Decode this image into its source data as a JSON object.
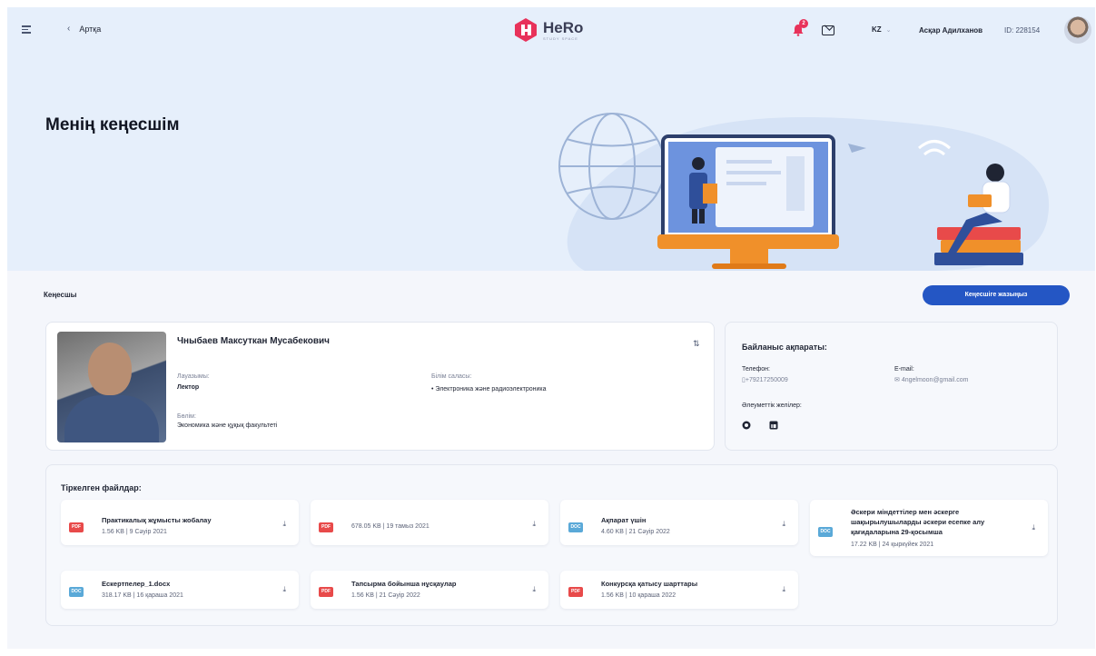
{
  "header": {
    "back_label": "Артқа",
    "logo_text": "HeRo",
    "logo_sub": "STUDY SPACE",
    "notification_count": "2",
    "lang": "KZ",
    "user_name": "Асқар Адилханов",
    "user_id": "ID: 228154"
  },
  "page": {
    "title": "Менің кеңесшім"
  },
  "consultant": {
    "section_label": "Кеңесшы",
    "signup_button": "Кеңесшіге жазыңыз",
    "name": "Чныбаев Максуткан Мусабекович",
    "position_label": "Лауазымы:",
    "position_value": "Лектор",
    "department_label": "Бөлім:",
    "department_value": "Экономика және құқық факультеті",
    "field_label": "Білім саласы:",
    "field_value": "• Электроника және радиоэлектроника"
  },
  "contacts": {
    "title": "Байланыс ақпараты:",
    "phone_label": "Телефон:",
    "phone_value": "+79217250009",
    "email_label": "E-mail:",
    "email_value": "4ngelmoon@gmail.com",
    "social_label": "Әлеуметтік желілер:"
  },
  "files": {
    "title": "Тіркелген файлдар:",
    "items": [
      {
        "type": "PDF",
        "name": "Практикалық жұмысты жобалау",
        "size": "1.56 KB",
        "date": "9 Сәуір 2021"
      },
      {
        "type": "PDF",
        "name": "",
        "size": "678.05 KB",
        "date": "19 тамыз 2021"
      },
      {
        "type": "DOC",
        "name": "Ақпарат үшін",
        "size": "4.60 KB",
        "date": "21 Сәуір 2022"
      },
      {
        "type": "DOC",
        "name": "Әскери міндеттілер мен әскерге шақырылушыларды әскери есепке алу қағидаларына 29-қосымша",
        "size": "17.22 KB",
        "date": "24 қыркүйек 2021"
      },
      {
        "type": "DOC",
        "name": "Ескертпелер_1.docx",
        "size": "318.17 KB",
        "date": "16 қараша 2021"
      },
      {
        "type": "PDF",
        "name": "Тапсырма бойынша нұсқаулар",
        "size": "1.56 KB",
        "date": "21 Сәуір 2022"
      },
      {
        "type": "PDF",
        "name": "Конкурсқа қатысу шарттары",
        "size": "1.56 KB",
        "date": "10 қараша 2022"
      }
    ]
  }
}
